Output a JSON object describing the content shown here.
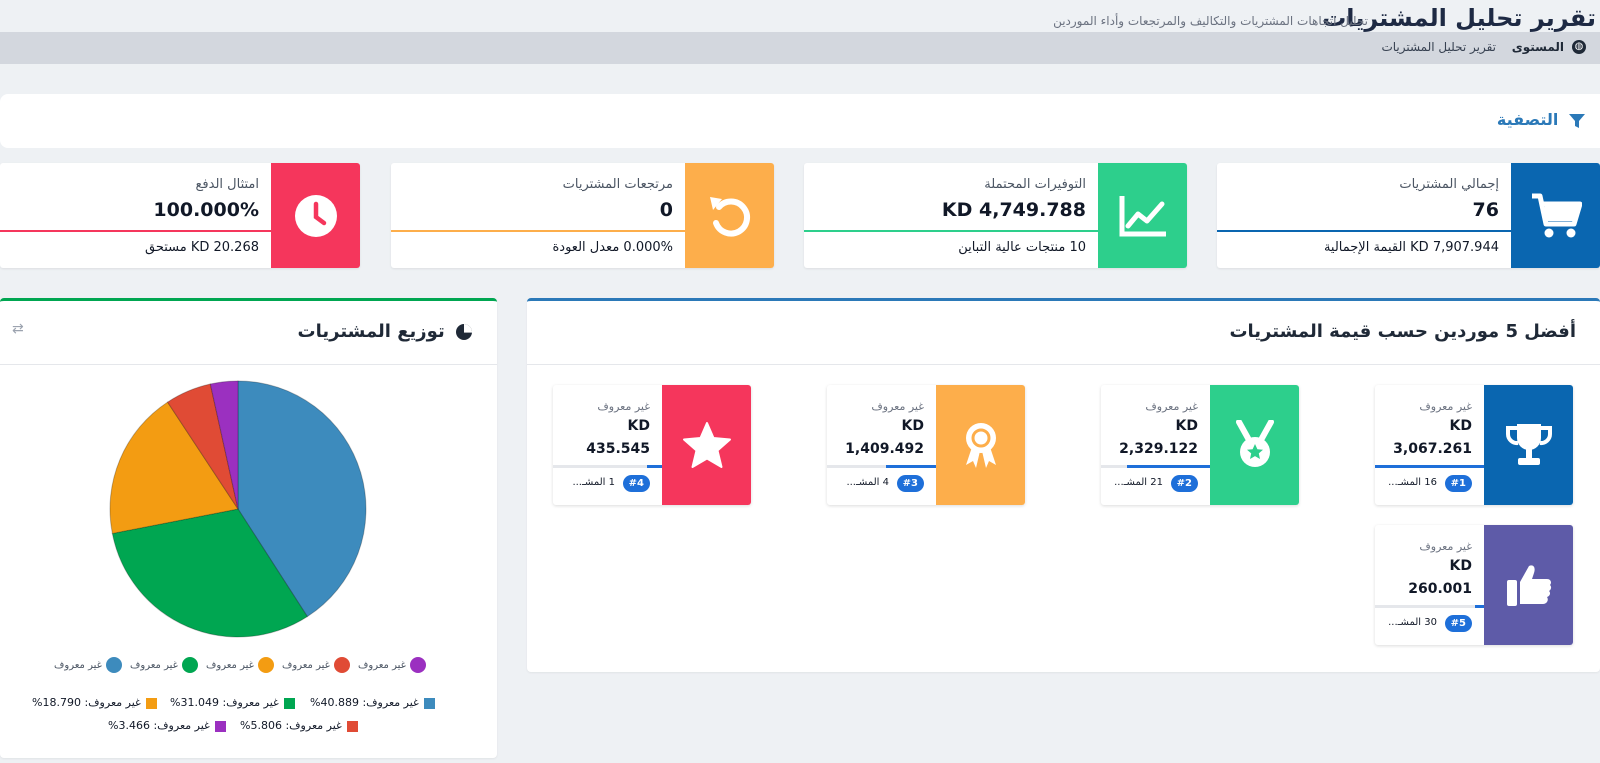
{
  "header": {
    "title": "تقرير تحليل المشتريات",
    "subtitle": "تحليل اتجاهات المشتريات والتكاليف والمرتجعات وأداء الموردين"
  },
  "breadcrumb": {
    "level": "المستوى",
    "current": "تقرير تحليل المشتريات"
  },
  "filter": {
    "title": "التصفية"
  },
  "stats": [
    {
      "label": "إجمالي المشتريات",
      "value": "76",
      "footer": "KD 7,907.944 القيمة الإجمالية",
      "color": "#0a66b0",
      "icon": "cart-icon"
    },
    {
      "label": "التوفيرات المحتملة",
      "value": "KD 4,749.788",
      "footer": "10 منتجات عالية التباين",
      "color": "#2dcf8c",
      "icon": "trend-chart-icon"
    },
    {
      "label": "مرتجعات المشتريات",
      "value": "0",
      "footer": "0.000% معدل العودة",
      "color": "#fdae4b",
      "icon": "undo-icon"
    },
    {
      "label": "امتثال الدفع",
      "value": "100.000%",
      "footer": "KD 20.268 مستحق",
      "color": "#f5365c",
      "icon": "clock-icon"
    }
  ],
  "suppliers": {
    "title": "أفضل 5 موردين حسب قيمة المشتريات",
    "items": [
      {
        "name": "غير معروف",
        "currency": "KD",
        "value": "3,067.261",
        "rank": "#1",
        "count": "16 المشـ...",
        "color": "#0a66b0",
        "icon": "trophy-icon",
        "share": 1.0
      },
      {
        "name": "غير معروف",
        "currency": "KD",
        "value": "2,329.122",
        "rank": "#2",
        "count": "21 المشـ...",
        "color": "#2dcf8c",
        "icon": "medal-icon",
        "share": 0.76
      },
      {
        "name": "غير معروف",
        "currency": "KD",
        "value": "1,409.492",
        "rank": "#3",
        "count": "4 المشـ...",
        "color": "#fdae4b",
        "icon": "award-icon",
        "share": 0.46
      },
      {
        "name": "غير معروف",
        "currency": "KD",
        "value": "435.545",
        "rank": "#4",
        "count": "1 المشـ...",
        "color": "#f5365c",
        "icon": "star-icon",
        "share": 0.14
      },
      {
        "name": "غير معروف",
        "currency": "KD",
        "value": "260.001",
        "rank": "#5",
        "count": "30 المشـ...",
        "color": "#5e5ba8",
        "icon": "thumbs-up-icon",
        "share": 0.08
      }
    ]
  },
  "distribution": {
    "title": "توزيع المشتريات",
    "swap_icon": "⇄",
    "legend_label": "غير معروف",
    "percent_labels": [
      "غير معروف: 40.889%",
      "غير معروف: 31.049%",
      "غير معروف: 18.790%",
      "غير معروف: 5.806%",
      "غير معروف: 3.466%"
    ]
  },
  "chart_data": {
    "type": "pie",
    "categories": [
      "غير معروف",
      "غير معروف",
      "غير معروف",
      "غير معروف",
      "غير معروف"
    ],
    "values": [
      40.889,
      31.049,
      18.79,
      5.806,
      3.466
    ],
    "colors": [
      "#3d8bbd",
      "#00a651",
      "#f39c12",
      "#e04b35",
      "#9b30c0"
    ],
    "legend": "bottom"
  }
}
